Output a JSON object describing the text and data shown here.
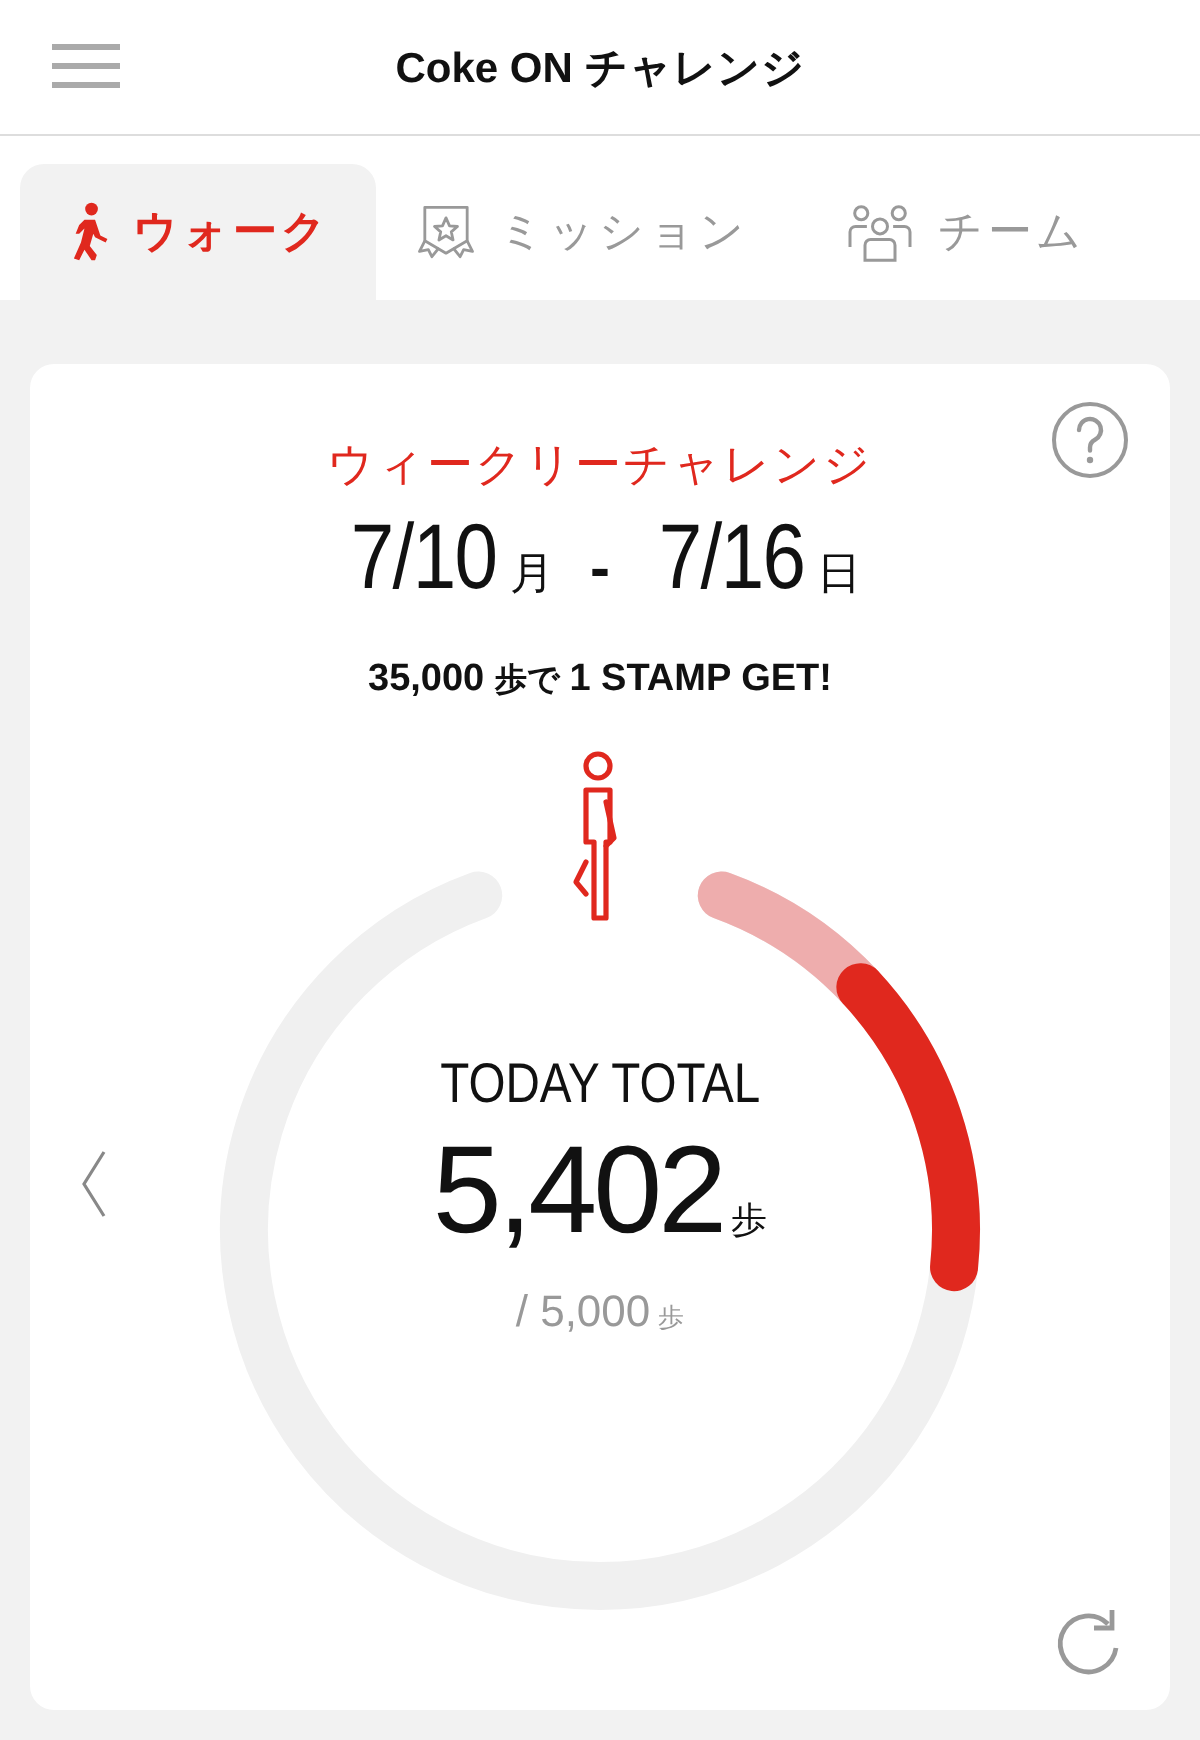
{
  "header": {
    "title": "Coke ON チャレンジ"
  },
  "tabs": [
    {
      "kind": "walk",
      "label": "ウォーク",
      "selected": true
    },
    {
      "kind": "mission",
      "label": "ミッション",
      "selected": false
    },
    {
      "kind": "team",
      "label": "チーム",
      "selected": false
    }
  ],
  "challenge": {
    "title": "ウィークリーチャレンジ",
    "start_date": "7/10",
    "start_day": "月",
    "separator": "-",
    "end_date": "7/16",
    "end_day": "日",
    "goal_steps": "35,000",
    "goal_unit": "歩で",
    "goal_reward": "1 STAMP GET!"
  },
  "ring": {
    "label": "TODAY TOTAL",
    "steps": "5,402",
    "steps_unit": "歩",
    "target": "/ 5,000",
    "target_unit": "歩"
  }
}
